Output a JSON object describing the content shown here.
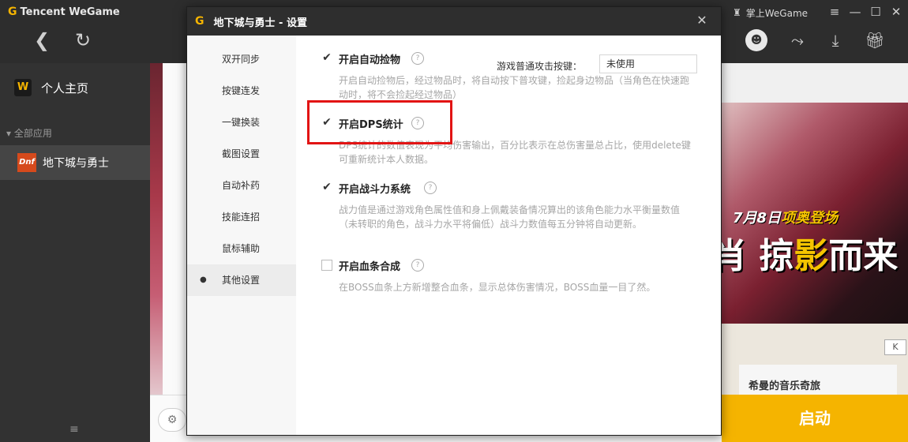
{
  "app": {
    "brand_prefix": "G",
    "brand_name": "Tencent WeGame",
    "mobile_label": "掌上WeGame",
    "back_glyph": "❮",
    "refresh_glyph": "↻"
  },
  "sidebar": {
    "home_logo": "W",
    "home_label": "个人主页",
    "section_label": "▾ 全部应用",
    "game_icon_text": "Dnf",
    "game_label": "地下城与勇士",
    "menu_glyph": "≡"
  },
  "background": {
    "banner_date_prefix": "7月8日",
    "banner_date_hl": "项奥登场",
    "banner_slogan_a": "肖 掠",
    "banner_slogan_b": "影",
    "banner_slogan_c": "而来",
    "music_title": "希曼的音乐奇旅",
    "key_button": "K",
    "start_button": "启动",
    "search_glyph": "⚙"
  },
  "dialog": {
    "logo": "G",
    "title": "地下城与勇士 - 设置",
    "close_glyph": "✕",
    "nav": [
      {
        "label": "双开同步"
      },
      {
        "label": "按键连发"
      },
      {
        "label": "一键换装"
      },
      {
        "label": "截图设置"
      },
      {
        "label": "自动补药"
      },
      {
        "label": "技能连招"
      },
      {
        "label": "鼠标辅助"
      },
      {
        "label": "其他设置",
        "active": true
      }
    ],
    "options": [
      {
        "label": "开启自动捡物",
        "checked": true,
        "desc": "开启自动捡物后，经过物品时，将自动按下普攻键，捡起身边物品（当角色在快速跑动时，将不会捡起经过物品）"
      },
      {
        "label": "开启DPS统计",
        "checked": true,
        "desc": "DPS统计的数值表现为平均伤害输出，百分比表示在总伤害量总占比，使用delete键可重新统计本人数据。"
      },
      {
        "label": "开启战斗力系统",
        "checked": true,
        "desc": "战力值是通过游戏角色属性值和身上佩戴装备情况算出的该角色能力水平衡量数值（未转职的角色，战斗力水平将偏低）战斗力数值每五分钟将自动更新。"
      },
      {
        "label": "开启血条合成",
        "checked": false,
        "desc": "在BOSS血条上方新增整合血条，显示总体伤害情况，BOSS血量一目了然。"
      }
    ],
    "attack_key_label": "游戏普通攻击按键：",
    "attack_key_value": "未使用",
    "check_glyph": "✔",
    "help_glyph": "?"
  },
  "colors": {
    "accent": "#f5b400",
    "highlight": "#e21414",
    "dark": "#2e2e2e"
  }
}
